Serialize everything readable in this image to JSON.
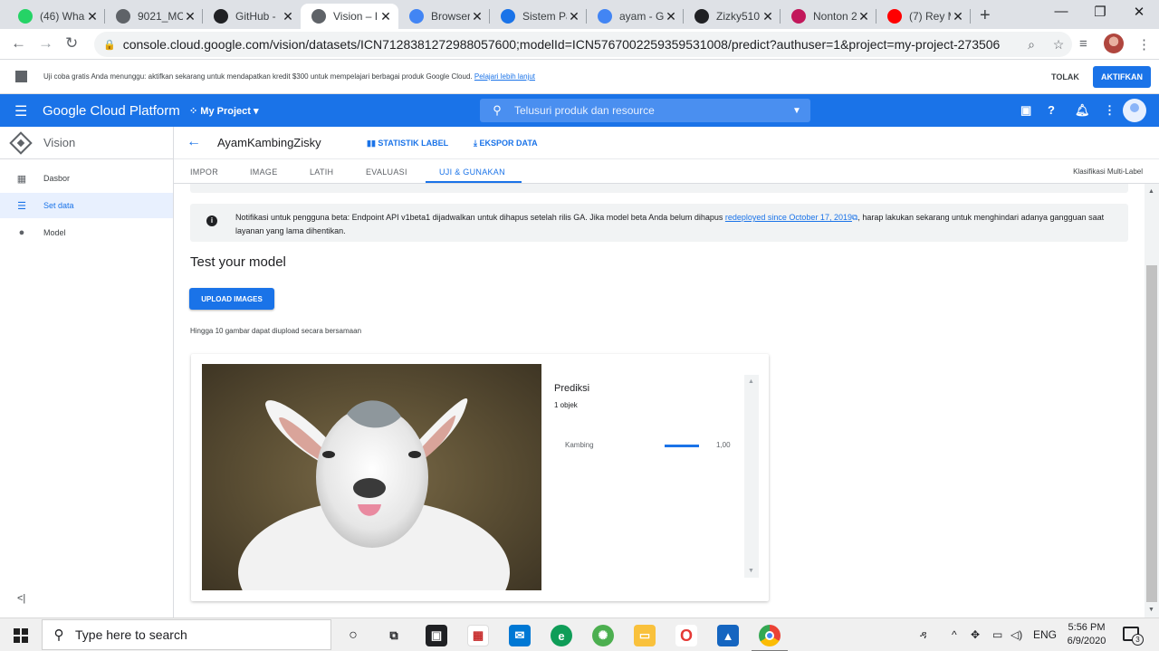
{
  "browser": {
    "tabs": [
      {
        "label": "(46) Wha",
        "icon": "whatsapp-icon",
        "color": "#25d366"
      },
      {
        "label": "9021_MC",
        "icon": "globe-icon",
        "color": "#5f6368"
      },
      {
        "label": "GitHub -",
        "icon": "github-icon",
        "color": "#202124"
      },
      {
        "label": "Vision – I",
        "icon": "vision-icon",
        "color": "#5f6368"
      },
      {
        "label": "Browser",
        "icon": "browser-icon",
        "color": "#4285f4"
      },
      {
        "label": "Sistem Pa",
        "icon": "classroom-icon",
        "color": "#1a73e8"
      },
      {
        "label": "ayam - G",
        "icon": "google-icon",
        "color": "#4285f4"
      },
      {
        "label": "Zizky510",
        "icon": "github-icon",
        "color": "#202124"
      },
      {
        "label": "Nonton 2",
        "icon": "nonton-icon",
        "color": "#c2185b"
      },
      {
        "label": "(7) Rey M",
        "icon": "youtube-icon",
        "color": "#ff0000"
      }
    ],
    "url": "console.cloud.google.com/vision/datasets/ICN7128381272988057600;modelId=ICN5767002259359531008/predict?authuser=1&project=my-project-273506"
  },
  "trial_banner": {
    "text": "Uji coba gratis Anda menunggu: aktifkan sekarang untuk mendapatkan kredit $300 untuk mempelajari berbagai produk Google Cloud.",
    "link": "Pelajari lebih lanjut",
    "dismiss_label": "TOLAK",
    "activate_label": "AKTIFKAN"
  },
  "header": {
    "brand": "Google Cloud Platform",
    "project": "My Project",
    "search_placeholder": "Telusuri produk dan resource",
    "accent": "#1a73e8"
  },
  "sidebar": {
    "product": "Vision",
    "items": [
      {
        "label": "Dasbor",
        "icon": "dashboard-icon"
      },
      {
        "label": "Set data",
        "icon": "list-icon"
      },
      {
        "label": "Model",
        "icon": "lightbulb-icon"
      }
    ],
    "collapse": "<|"
  },
  "dataset": {
    "name": "AyamKambingZisky",
    "actions": {
      "label_stats": "STATISTIK LABEL",
      "export": "EKSPOR DATA"
    },
    "tabs": [
      "IMPOR",
      "IMAGE",
      "LATIH",
      "EVALUASI",
      "UJI & GUNAKAN"
    ],
    "active_tab": "UJI & GUNAKAN",
    "model_type": "Klasifikasi Multi-Label"
  },
  "notice": {
    "text_before": "Notifikasi untuk pengguna beta: Endpoint API v1beta1 dijadwalkan untuk dihapus setelah rilis GA. Jika model beta Anda belum dihapus",
    "link": "redeployed since October 17, 2019",
    "text_after": ", harap lakukan sekarang untuk menghindari adanya gangguan saat layanan yang lama dihentikan."
  },
  "test": {
    "title": "Test your model",
    "upload_label": "UPLOAD IMAGES",
    "hint": "Hingga 10 gambar dapat diupload secara bersamaan"
  },
  "prediction": {
    "title": "Prediksi",
    "count": "1 objek",
    "results": [
      {
        "label": "Kambing",
        "score": "1,00",
        "fraction": 1.0
      }
    ]
  },
  "taskbar": {
    "search_placeholder": "Type here to search",
    "language": "ENG",
    "time": "5:56 PM",
    "date": "6/9/2020",
    "notifications": "3"
  }
}
